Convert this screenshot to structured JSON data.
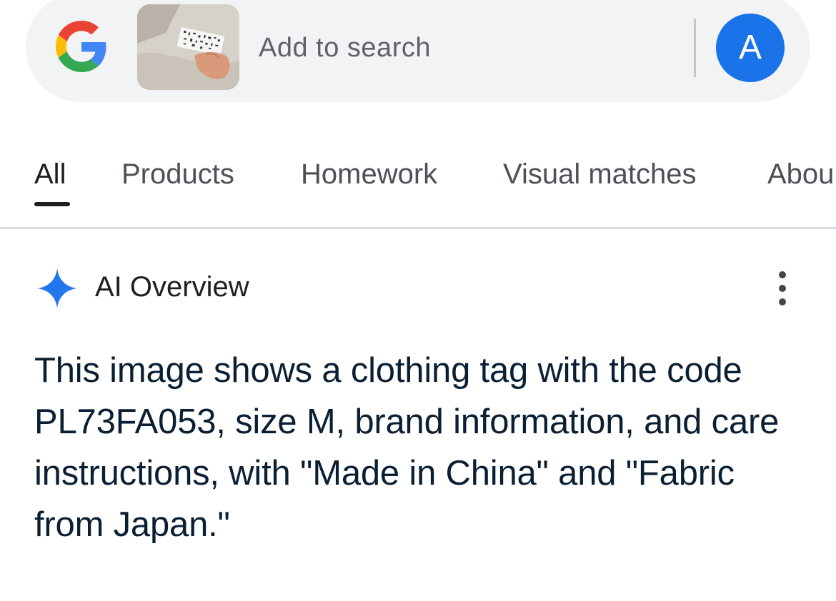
{
  "search": {
    "placeholder": "Add to search",
    "avatar_letter": "A",
    "logo_icon": "google-g-icon",
    "thumbnail_icon": "image-thumbnail"
  },
  "tabs": [
    {
      "label": "All",
      "active": true
    },
    {
      "label": "Products",
      "active": false
    },
    {
      "label": "Homework",
      "active": false
    },
    {
      "label": "Visual matches",
      "active": false
    },
    {
      "label": "Abou",
      "active": false
    }
  ],
  "overview": {
    "title": "AI Overview",
    "icon": "sparkle-icon",
    "menu_icon": "more-vertical-icon",
    "body": "This image shows a clothing tag with the code PL73FA053, size M, brand information, and care instructions, with \"Made in China\" and \"Fabric from Japan.\""
  },
  "colors": {
    "accent": "#1a73e8",
    "search_bg": "#f1f3f4",
    "body_text": "#0b1f33"
  }
}
